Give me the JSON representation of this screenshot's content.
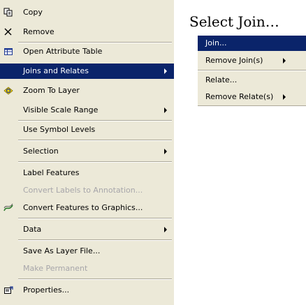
{
  "context_menu": {
    "items": [
      {
        "label": "Copy",
        "icon": "copy-icon",
        "disabled": false,
        "submenu": false
      },
      {
        "label": "Remove",
        "icon": "remove-x-icon",
        "disabled": false,
        "submenu": false
      },
      {
        "label": "Open Attribute Table",
        "icon": "table-icon",
        "disabled": false,
        "submenu": false
      },
      {
        "label": "Joins and Relates",
        "icon": "",
        "disabled": false,
        "submenu": true,
        "highlighted": true
      },
      {
        "label": "Zoom To Layer",
        "icon": "zoom-to-layer-icon",
        "disabled": false,
        "submenu": false
      },
      {
        "label": "Visible Scale Range",
        "icon": "",
        "disabled": false,
        "submenu": true
      },
      {
        "label": "Use Symbol Levels",
        "icon": "",
        "disabled": false,
        "submenu": false
      },
      {
        "label": "Selection",
        "icon": "",
        "disabled": false,
        "submenu": true
      },
      {
        "label": "Label Features",
        "icon": "",
        "disabled": false,
        "submenu": false
      },
      {
        "label": "Convert Labels to Annotation...",
        "icon": "",
        "disabled": true,
        "submenu": false
      },
      {
        "label": "Convert Features to Graphics...",
        "icon": "convert-graphics-icon",
        "disabled": false,
        "submenu": false
      },
      {
        "label": "Data",
        "icon": "",
        "disabled": false,
        "submenu": true
      },
      {
        "label": "Save As Layer File...",
        "icon": "",
        "disabled": false,
        "submenu": false
      },
      {
        "label": "Make Permanent",
        "icon": "",
        "disabled": true,
        "submenu": false
      },
      {
        "label": "Properties...",
        "icon": "properties-icon",
        "disabled": false,
        "submenu": false
      }
    ]
  },
  "submenu": {
    "title": "Select Join…",
    "items": [
      {
        "label": "Join...",
        "highlighted": true,
        "submenu": false
      },
      {
        "label": "Remove Join(s)",
        "highlighted": false,
        "submenu": true
      },
      {
        "label": "Relate...",
        "highlighted": false,
        "submenu": false
      },
      {
        "label": "Remove Relate(s)",
        "highlighted": false,
        "submenu": true
      }
    ]
  },
  "colors": {
    "menu_bg": "#ece9d8",
    "highlight_bg": "#0a246a",
    "disabled_text": "#a7a6aa",
    "separator": "#aca899"
  }
}
